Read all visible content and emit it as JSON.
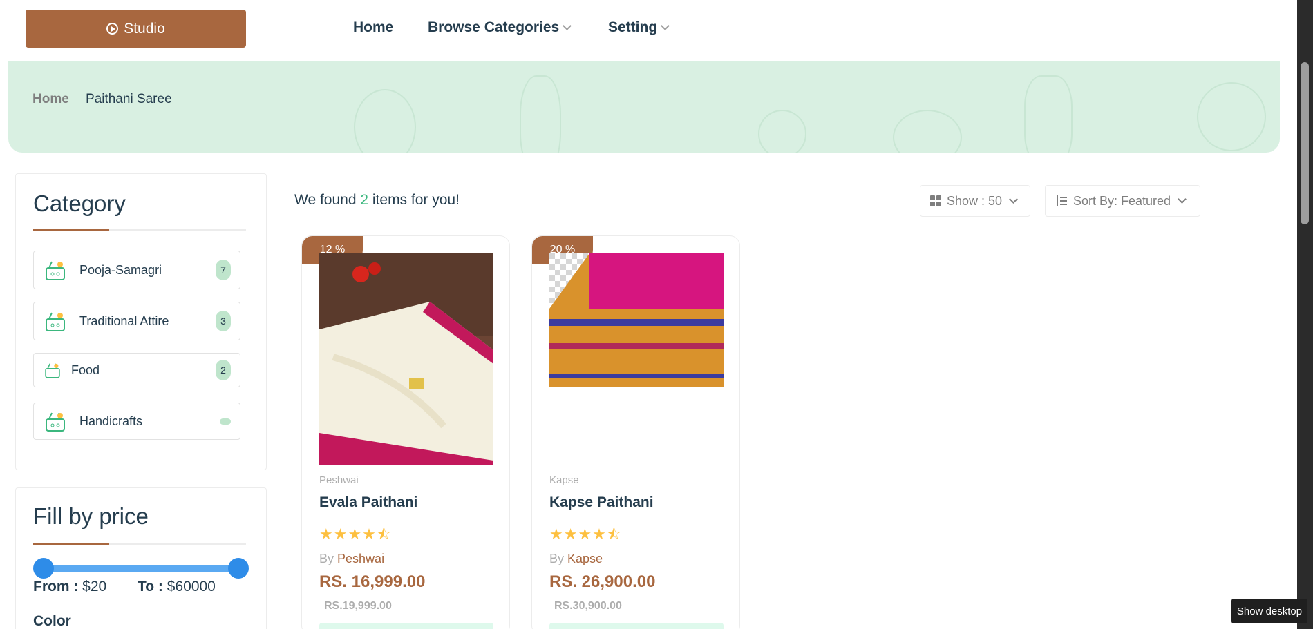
{
  "header": {
    "logo_label": "Studio",
    "nav": [
      {
        "label": "Home"
      },
      {
        "label": "Browse Categories"
      },
      {
        "label": "Setting"
      }
    ]
  },
  "breadcrumb": {
    "home": "Home",
    "current": "Paithani Saree"
  },
  "sidebar": {
    "category_title": "Category",
    "categories": [
      {
        "label": "Pooja-Samagri",
        "count": "7"
      },
      {
        "label": "Traditional Attire",
        "count": "3"
      },
      {
        "label": "Food",
        "count": "2"
      },
      {
        "label": "Handicrafts",
        "count": ""
      }
    ],
    "price_title": "Fill by price",
    "price_from_label": "From :",
    "price_from": "$20",
    "price_to_label": "To :",
    "price_to": "$60000",
    "color_title": "Color"
  },
  "main": {
    "found_prefix": "We found",
    "found_count": "2",
    "found_suffix": "items for you!",
    "show_label": "Show : 50",
    "sort_label": "Sort By: Featured"
  },
  "products": [
    {
      "discount": "12 %",
      "brand": "Peshwai",
      "name": "Evala Paithani",
      "rating": 4.5,
      "stars": "★★★★⯪",
      "by_label": "By",
      "by": "Peshwai",
      "price": "RS. 16,999.00",
      "old_price": "RS.19,999.00"
    },
    {
      "discount": "20 %",
      "brand": "Kapse",
      "name": "Kapse Paithani",
      "rating": 4.5,
      "stars": "★★★★⯪",
      "by_label": "By",
      "by": "Kapse",
      "price": "RS. 26,900.00",
      "old_price": "RS.30,900.00"
    }
  ],
  "taskbar": {
    "show_desktop": "Show desktop"
  },
  "colors": {
    "brand": "#a8673f",
    "accent_green": "#3bb77e",
    "banner": "#d9f0e2",
    "slider": "#2e8ce8"
  }
}
